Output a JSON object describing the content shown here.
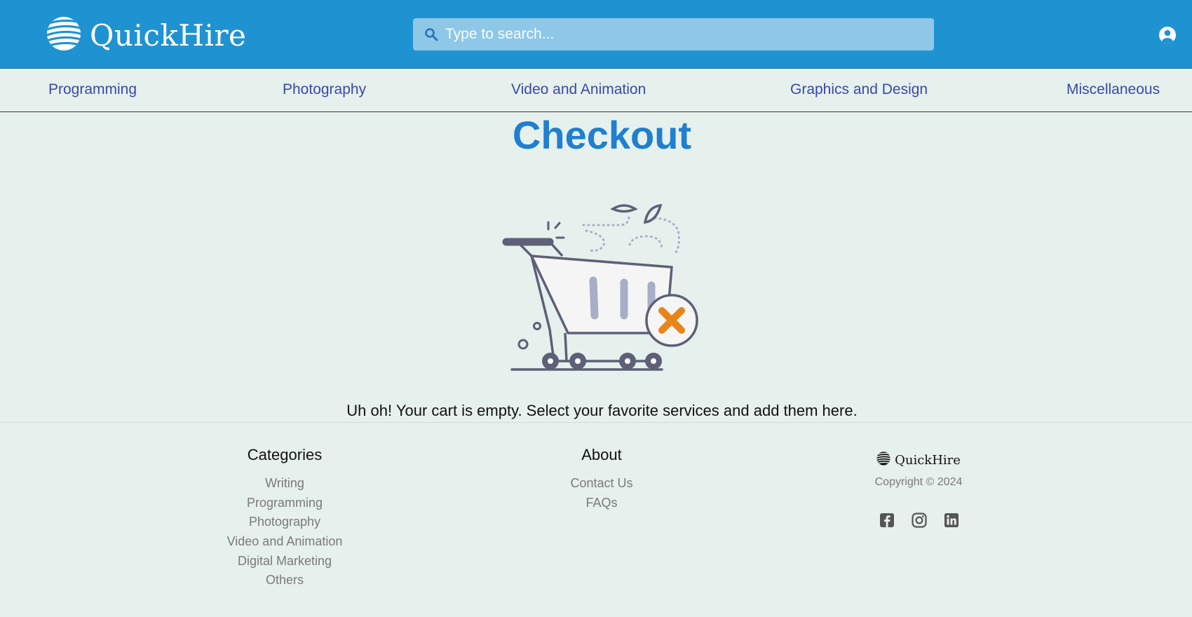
{
  "header": {
    "brand": "QuickHire",
    "search_placeholder": "Type to search...",
    "icons": {
      "logo": "striped-globe-icon",
      "search": "search-icon",
      "account": "user-circle-icon"
    },
    "colors": {
      "bar": "#1f93d1",
      "search_bg": "#8ec8e6"
    }
  },
  "nav": {
    "items": [
      "Programming",
      "Photography",
      "Video and Animation",
      "Graphics and Design",
      "Miscellaneous"
    ],
    "color": "#3a48a8"
  },
  "main": {
    "title": "Checkout",
    "empty_message": "Uh oh! Your cart is empty. Select your favorite services and add them here.",
    "illustration": "empty-cart-icon",
    "colors": {
      "title": "#1f7fd0",
      "remove_mark": "#e8851a"
    }
  },
  "footer": {
    "categories": {
      "heading": "Categories",
      "links": [
        "Writing",
        "Programming",
        "Photography",
        "Video and Animation",
        "Digital Marketing",
        "Others"
      ]
    },
    "about": {
      "heading": "About",
      "links": [
        "Contact Us",
        "FAQs"
      ]
    },
    "brand": "QuickHire",
    "copyright": "Copyright © 2024",
    "social_icons": [
      "facebook-icon",
      "instagram-icon",
      "linkedin-icon"
    ]
  }
}
